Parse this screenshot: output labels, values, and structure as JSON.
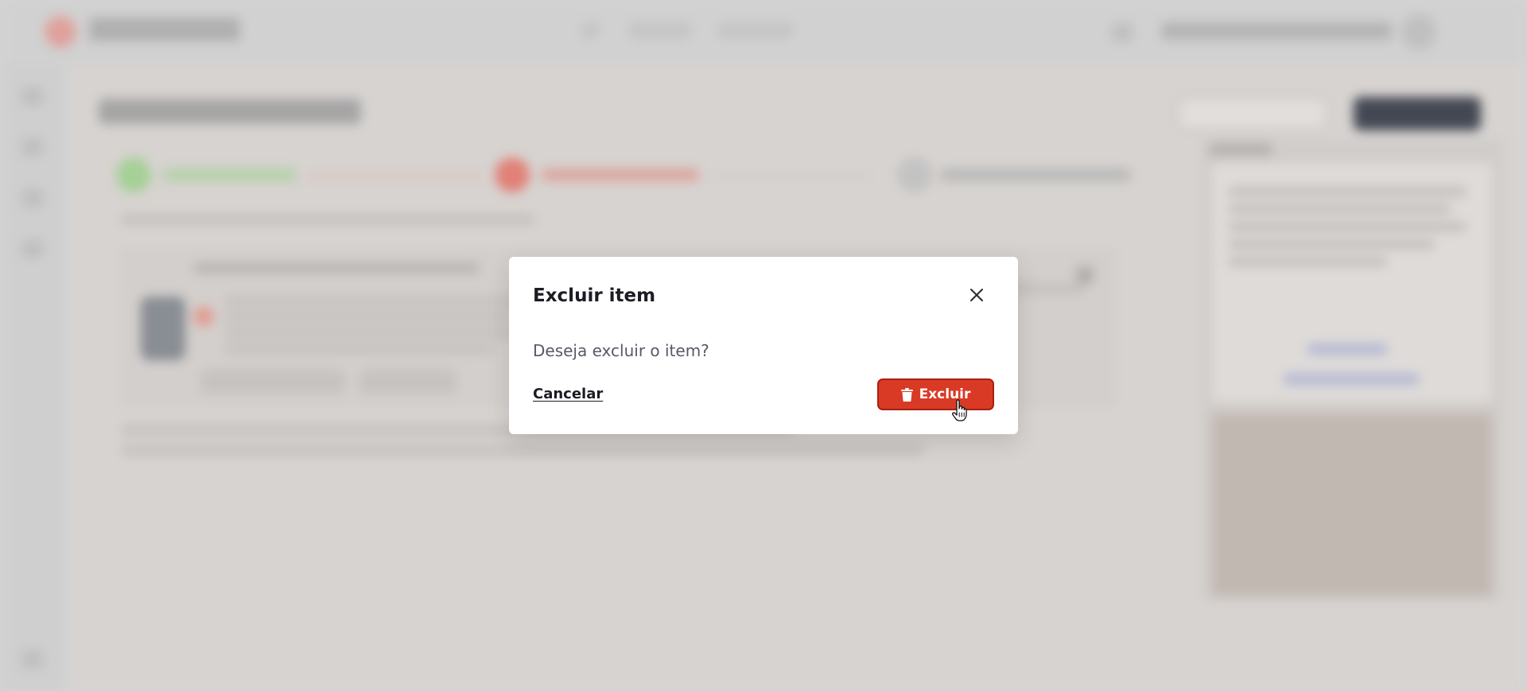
{
  "modal": {
    "title": "Excluir item",
    "message": "Deseja excluir o item?",
    "cancel_label": "Cancelar",
    "confirm_label": "Excluir",
    "confirm_icon": "trash-icon",
    "close_icon": "close-icon",
    "confirm_color": "#d93a26"
  },
  "colors": {
    "step_done": "#a9d59a",
    "step_active": "#e6847a",
    "step_pending": "#c7c7c7"
  }
}
